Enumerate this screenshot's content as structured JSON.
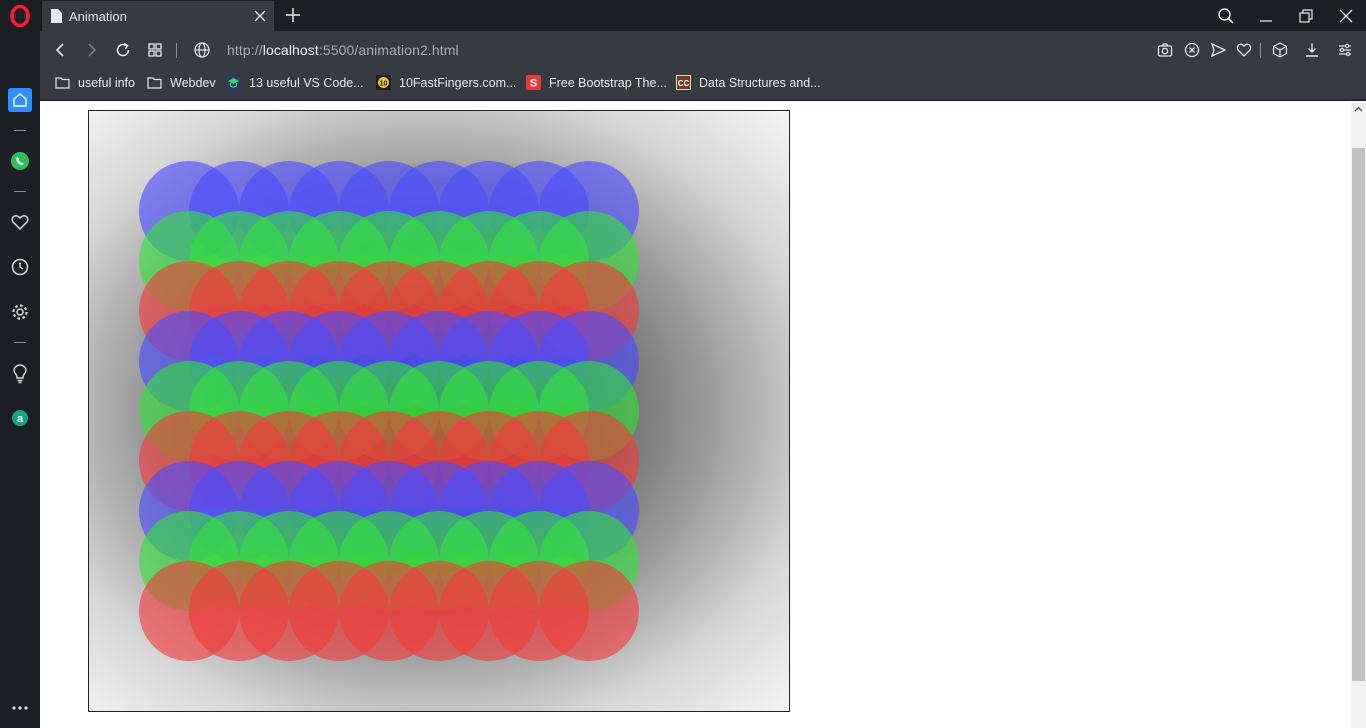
{
  "tab": {
    "title": "Animation"
  },
  "address": {
    "scheme": "http://",
    "host": "localhost",
    "rest": ":5500/animation2.html"
  },
  "bookmarks": [
    {
      "label": "useful info",
      "icon": "folder-icon"
    },
    {
      "label": "Webdev",
      "icon": "folder-icon"
    },
    {
      "label": "13 useful VS Code...",
      "icon": "graduation-cap-icon"
    },
    {
      "label": "10FastFingers.com...",
      "icon": "keyboard-badge-icon"
    },
    {
      "label": "Free Bootstrap The...",
      "icon": "s-logo-icon"
    },
    {
      "label": "Data Structures and...",
      "icon": "cc-logo-icon"
    }
  ],
  "sidebar": [
    "home-icon",
    "whatsapp-icon",
    "heart-icon",
    "history-icon",
    "settings-icon",
    "lightbulb-icon",
    "aria-icon",
    "more-icon"
  ],
  "canvas": {
    "grid_rows": 9,
    "grid_cols": 9,
    "row_color_pattern": [
      "#4b4cff",
      "#33e23a",
      "#f23a3a"
    ],
    "circle_opacity": 0.62
  },
  "colors": {
    "chrome_dark": "#1b1e23",
    "chrome_bar": "#353a43",
    "accent": "#2f8fff",
    "opera_red": "#ff1b2d"
  }
}
